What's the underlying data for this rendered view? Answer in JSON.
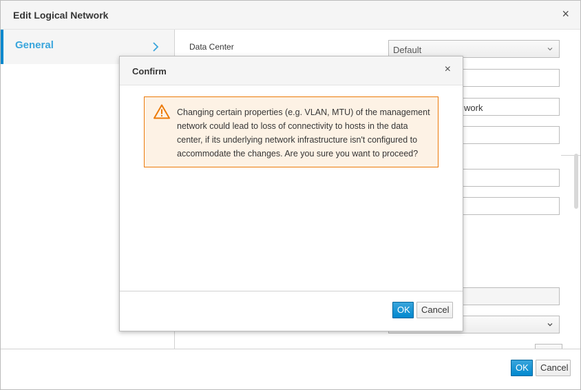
{
  "outer_dialog": {
    "title": "Edit Logical Network",
    "close_glyph": "×",
    "sidebar": {
      "items": [
        {
          "label": "General",
          "icon": "chevron-right-icon"
        }
      ]
    },
    "form": {
      "data_center_label": "Data Center",
      "data_center_value": "Default",
      "name_field_partial": "work"
    },
    "footer": {
      "ok_label": "OK",
      "cancel_label": "Cancel"
    }
  },
  "confirm_dialog": {
    "title": "Confirm",
    "close_glyph": "×",
    "alert": {
      "icon": "warning-triangle-icon",
      "message": "Changing certain properties (e.g. VLAN, MTU) of the management network could lead to loss of connectivity to hosts in the data center, if its underlying network infrastructure isn't configured to accommodate the changes. Are you sure you want to proceed?"
    },
    "footer": {
      "ok_label": "OK",
      "cancel_label": "Cancel"
    }
  },
  "colors": {
    "accent": "#0088ce",
    "link": "#39a5dc",
    "warning_border": "#ec7a08",
    "warning_bg": "#fdf2e5"
  }
}
